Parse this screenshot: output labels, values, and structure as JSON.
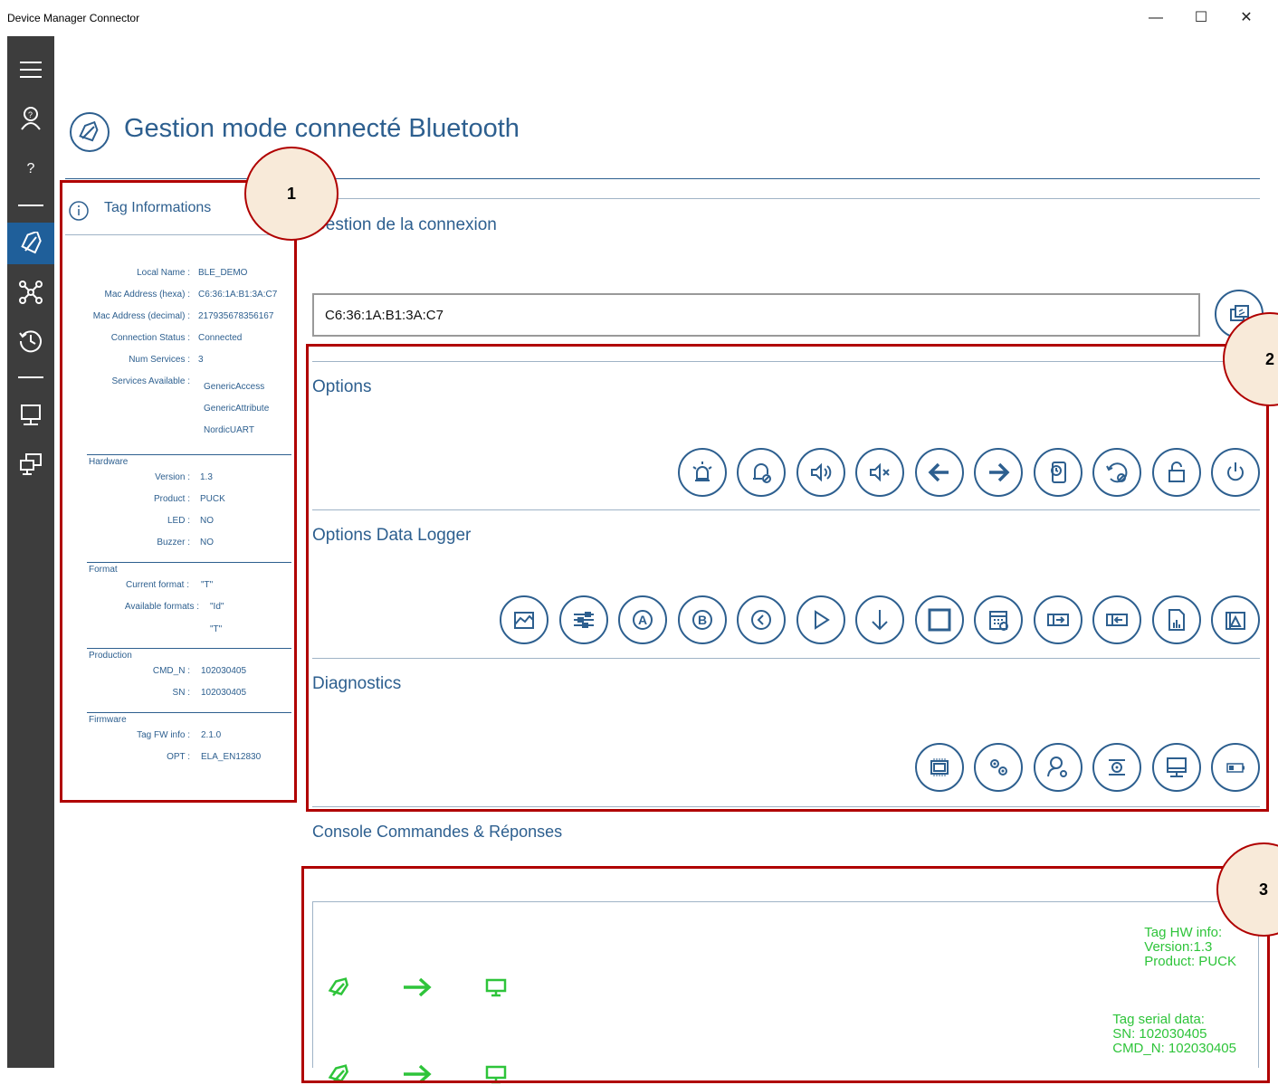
{
  "window": {
    "title": "Device Manager Connector",
    "minimize": "—",
    "maximize": "☐",
    "close": "✕"
  },
  "sidebar": {
    "items": [
      {
        "icon": "hamburger-icon"
      },
      {
        "icon": "user-help-icon"
      },
      {
        "icon": "question-icon",
        "label": "?"
      },
      {
        "icon": "tag-icon",
        "active": true
      },
      {
        "icon": "network-icon"
      },
      {
        "icon": "history-icon"
      },
      {
        "icon": "computer-icon"
      },
      {
        "icon": "remote-desktop-icon"
      }
    ]
  },
  "page": {
    "title": "Gestion mode connecté Bluetooth"
  },
  "tag_info": {
    "header": "Tag Informations",
    "rows": [
      {
        "label": "Local Name :",
        "value": "BLE_DEMO"
      },
      {
        "label": "Mac Address (hexa) :",
        "value": "C6:36:1A:B1:3A:C7"
      },
      {
        "label": "Mac Address (decimal) :",
        "value": "217935678356167"
      },
      {
        "label": "Connection Status :",
        "value": "Connected"
      },
      {
        "label": "Num Services :",
        "value": "3"
      },
      {
        "label": "Services Available :",
        "value": ""
      }
    ],
    "services": [
      "GenericAccess",
      "GenericAttribute",
      "NordicUART"
    ],
    "hardware": {
      "title": "Hardware",
      "rows": [
        {
          "label": "Version :",
          "value": "1.3"
        },
        {
          "label": "Product :",
          "value": "PUCK"
        },
        {
          "label": "LED :",
          "value": "NO"
        },
        {
          "label": "Buzzer :",
          "value": "NO"
        }
      ]
    },
    "format": {
      "title": "Format",
      "current_label": "Current format :",
      "current_value": "\"T\"",
      "available_label": "Available formats :",
      "available_values": [
        "\"Id\"",
        "\"T\""
      ]
    },
    "production": {
      "title": "Production",
      "rows": [
        {
          "label": "CMD_N :",
          "value": "102030405"
        },
        {
          "label": "SN :",
          "value": "102030405"
        }
      ]
    },
    "firmware": {
      "title": "Firmware",
      "rows": [
        {
          "label": "Tag FW info :",
          "value": "2.1.0"
        },
        {
          "label": "OPT :",
          "value": "ELA_EN12830"
        }
      ]
    }
  },
  "connection": {
    "title": "Gestion de la connexion",
    "address_value": "C6:36:1A:B1:3A:C7",
    "connect_icon": "bluetooth-connect-icon"
  },
  "options": {
    "title": "Options",
    "buttons": [
      "led-on-icon",
      "alarm-off-icon",
      "sound-on-icon",
      "sound-mute-icon",
      "arrow-left-icon",
      "arrow-right-icon",
      "reset-timer-icon",
      "reset-icon",
      "lock-icon",
      "power-icon"
    ]
  },
  "datalogger": {
    "title": "Options Data Logger",
    "buttons": [
      "chart-area-icon",
      "settings-sliders-icon",
      "letter-a-icon",
      "letter-b-icon",
      "chevron-left-icon",
      "play-icon",
      "download-icon",
      "stop-icon",
      "calendar-icon",
      "export-icon",
      "import-icon",
      "report-icon",
      "chart-file-icon"
    ]
  },
  "diagnostics": {
    "title": "Diagnostics",
    "buttons": [
      "chip-icon",
      "gears-icon",
      "user-settings-icon",
      "device-settings-icon",
      "monitor-icon",
      "battery-icon"
    ]
  },
  "console": {
    "title": "Console Commandes & Réponses",
    "messages": [
      {
        "lines": [
          "Tag HW info:",
          "Version:1.3",
          "Product: PUCK"
        ]
      },
      {
        "lines": [
          "Tag serial data:",
          "SN: 102030405",
          "CMD_N: 102030405"
        ]
      }
    ]
  },
  "callouts": [
    "1",
    "2",
    "3"
  ],
  "colors": {
    "accent": "#2d5f8f",
    "sidebar": "#3d3d3d",
    "sidebar_active": "#1f5f9a",
    "highlight_red": "#b00000",
    "console_green": "#2ec43a"
  }
}
